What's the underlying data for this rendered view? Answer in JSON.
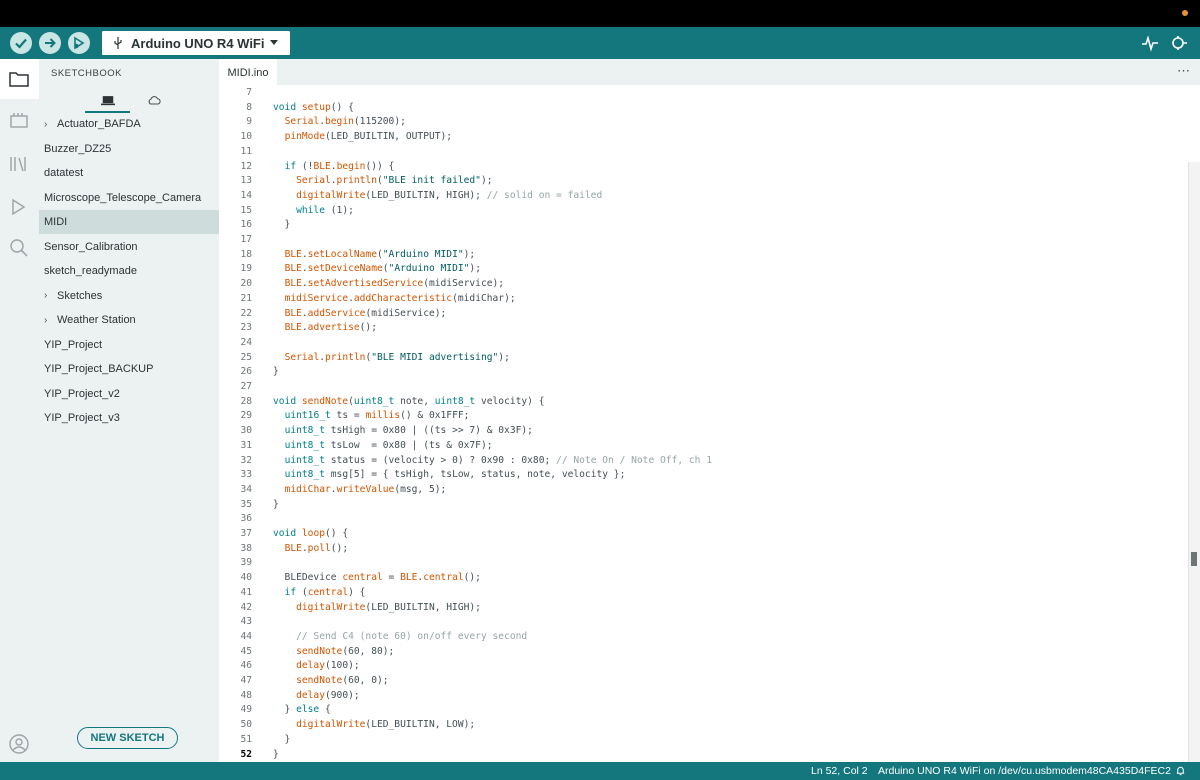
{
  "toolbar": {
    "board": "Arduino UNO R4 WiFi",
    "verify_icon": "check-icon",
    "upload_icon": "arrow-right-icon",
    "debug_icon": "debug-icon"
  },
  "sidebar": {
    "title": "SKETCHBOOK",
    "items": [
      {
        "label": "Actuator_BAFDA",
        "folder": true,
        "selected": false
      },
      {
        "label": "Buzzer_DZ25",
        "folder": false,
        "selected": false
      },
      {
        "label": "datatest",
        "folder": false,
        "selected": false
      },
      {
        "label": "Microscope_Telescope_Camera",
        "folder": false,
        "selected": false
      },
      {
        "label": "MIDI",
        "folder": false,
        "selected": true
      },
      {
        "label": "Sensor_Calibration",
        "folder": false,
        "selected": false
      },
      {
        "label": "sketch_readymade",
        "folder": false,
        "selected": false
      },
      {
        "label": "Sketches",
        "folder": true,
        "selected": false
      },
      {
        "label": "Weather Station",
        "folder": true,
        "selected": false
      },
      {
        "label": "YIP_Project",
        "folder": false,
        "selected": false
      },
      {
        "label": "YIP_Project_BACKUP",
        "folder": false,
        "selected": false
      },
      {
        "label": "YIP_Project_v2",
        "folder": false,
        "selected": false
      },
      {
        "label": "YIP_Project_v3",
        "folder": false,
        "selected": false
      }
    ],
    "new_sketch": "NEW SKETCH"
  },
  "editor": {
    "tab": "MIDI.ino",
    "current_line": 52,
    "lines": [
      {
        "n": 7,
        "t": ""
      },
      {
        "n": 8,
        "t": "void setup() {"
      },
      {
        "n": 9,
        "t": "  Serial.begin(115200);"
      },
      {
        "n": 10,
        "t": "  pinMode(LED_BUILTIN, OUTPUT);"
      },
      {
        "n": 11,
        "t": ""
      },
      {
        "n": 12,
        "t": "  if (!BLE.begin()) {"
      },
      {
        "n": 13,
        "t": "    Serial.println(\"BLE init failed\");"
      },
      {
        "n": 14,
        "t": "    digitalWrite(LED_BUILTIN, HIGH); // solid on = failed"
      },
      {
        "n": 15,
        "t": "    while (1);"
      },
      {
        "n": 16,
        "t": "  }"
      },
      {
        "n": 17,
        "t": ""
      },
      {
        "n": 18,
        "t": "  BLE.setLocalName(\"Arduino MIDI\");"
      },
      {
        "n": 19,
        "t": "  BLE.setDeviceName(\"Arduino MIDI\");"
      },
      {
        "n": 20,
        "t": "  BLE.setAdvertisedService(midiService);"
      },
      {
        "n": 21,
        "t": "  midiService.addCharacteristic(midiChar);"
      },
      {
        "n": 22,
        "t": "  BLE.addService(midiService);"
      },
      {
        "n": 23,
        "t": "  BLE.advertise();"
      },
      {
        "n": 24,
        "t": ""
      },
      {
        "n": 25,
        "t": "  Serial.println(\"BLE MIDI advertising\");"
      },
      {
        "n": 26,
        "t": "}"
      },
      {
        "n": 27,
        "t": ""
      },
      {
        "n": 28,
        "t": "void sendNote(uint8_t note, uint8_t velocity) {"
      },
      {
        "n": 29,
        "t": "  uint16_t ts = millis() & 0x1FFF;"
      },
      {
        "n": 30,
        "t": "  uint8_t tsHigh = 0x80 | ((ts >> 7) & 0x3F);"
      },
      {
        "n": 31,
        "t": "  uint8_t tsLow  = 0x80 | (ts & 0x7F);"
      },
      {
        "n": 32,
        "t": "  uint8_t status = (velocity > 0) ? 0x90 : 0x80; // Note On / Note Off, ch 1"
      },
      {
        "n": 33,
        "t": "  uint8_t msg[5] = { tsHigh, tsLow, status, note, velocity };"
      },
      {
        "n": 34,
        "t": "  midiChar.writeValue(msg, 5);"
      },
      {
        "n": 35,
        "t": "}"
      },
      {
        "n": 36,
        "t": ""
      },
      {
        "n": 37,
        "t": "void loop() {"
      },
      {
        "n": 38,
        "t": "  BLE.poll();"
      },
      {
        "n": 39,
        "t": ""
      },
      {
        "n": 40,
        "t": "  BLEDevice central = BLE.central();"
      },
      {
        "n": 41,
        "t": "  if (central) {"
      },
      {
        "n": 42,
        "t": "    digitalWrite(LED_BUILTIN, HIGH);"
      },
      {
        "n": 43,
        "t": ""
      },
      {
        "n": 44,
        "t": "    // Send C4 (note 60) on/off every second"
      },
      {
        "n": 45,
        "t": "    sendNote(60, 80);"
      },
      {
        "n": 46,
        "t": "    delay(100);"
      },
      {
        "n": 47,
        "t": "    sendNote(60, 0);"
      },
      {
        "n": 48,
        "t": "    delay(900);"
      },
      {
        "n": 49,
        "t": "  } else {"
      },
      {
        "n": 50,
        "t": "    digitalWrite(LED_BUILTIN, LOW);"
      },
      {
        "n": 51,
        "t": "  }"
      },
      {
        "n": 52,
        "t": "}"
      }
    ]
  },
  "status": {
    "position": "Ln 52, Col 2",
    "board_port": "Arduino UNO R4 WiFi on /dev/cu.usbmodem48CA435D4FEC2"
  },
  "colors": {
    "accent": "#14777e",
    "keyword": "#00818a",
    "function": "#d35400",
    "comment": "#95a5a6"
  }
}
